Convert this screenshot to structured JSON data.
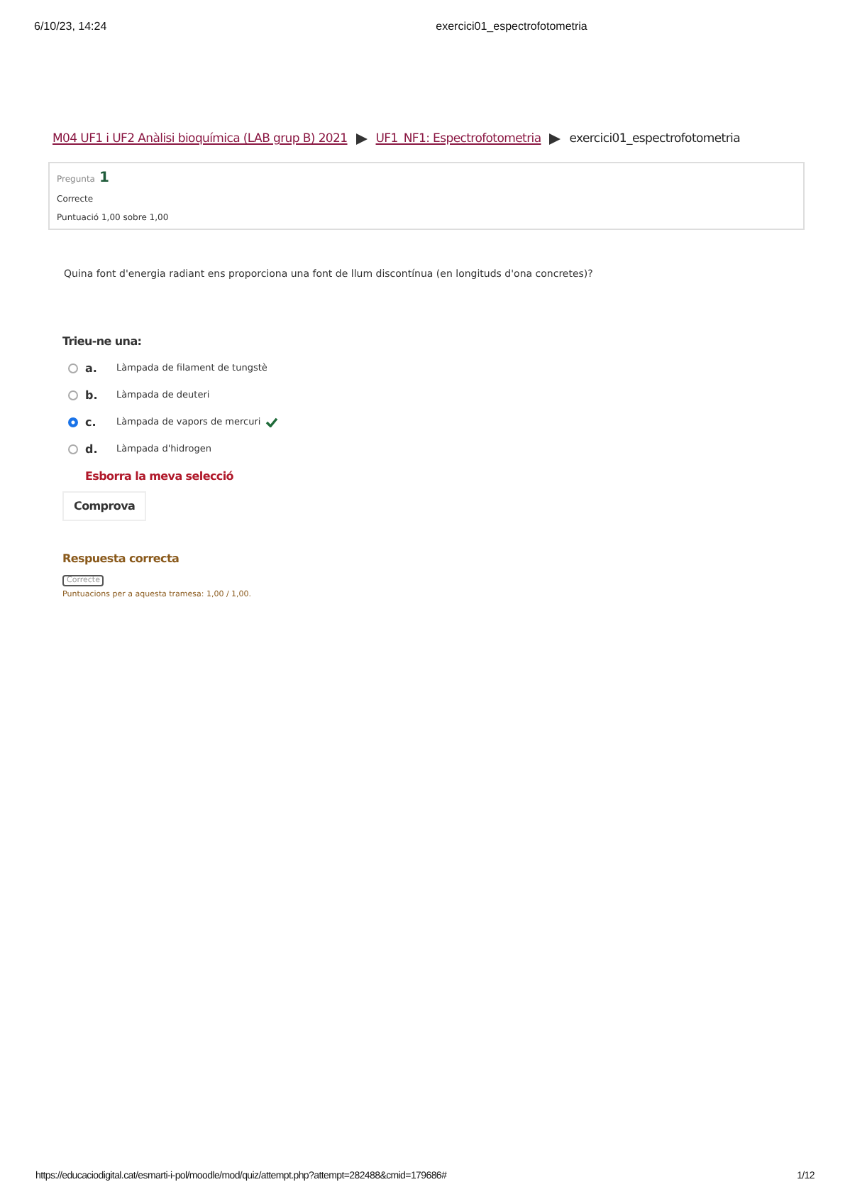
{
  "print_header": {
    "date": "6/10/23, 14:24",
    "title": "exercici01_espectrofotometria"
  },
  "breadcrumb": [
    {
      "label": "M04 UF1 i UF2 Anàlisi bioquímica (LAB grup B) 2021",
      "kind": "link"
    },
    {
      "label": "UF1_NF1: Espectrofotometria",
      "kind": "link"
    },
    {
      "label": "exercici01_espectrofotometria",
      "kind": "current"
    }
  ],
  "question_info": {
    "label": "Pregunta",
    "number": "1",
    "state": "Correcte",
    "grade": "Puntuació 1,00 sobre 1,00"
  },
  "question_text": "Quina font d'energia radiant ens proporciona una font de llum discontínua (en longituds d'ona concretes)?",
  "prompt": "Trieu-ne una:",
  "options": [
    {
      "letter": "a.",
      "label": "Làmpada de filament de tungstè",
      "selected": false,
      "correct": false
    },
    {
      "letter": "b.",
      "label": "Làmpada de deuteri",
      "selected": false,
      "correct": false
    },
    {
      "letter": "c.",
      "label": "Làmpada de vapors de mercuri",
      "selected": true,
      "correct": true
    },
    {
      "letter": "d.",
      "label": "Làmpada d'hidrogen",
      "selected": false,
      "correct": false
    }
  ],
  "clear_link": "Esborra la meva selecció",
  "check_button": "Comprova",
  "feedback": {
    "title": "Respuesta correcta",
    "badge": "Correcte",
    "marks": "Puntuacions per a aquesta tramesa: 1,00 / 1,00."
  },
  "print_footer": {
    "url": "https://educaciodigital.cat/esmarti-i-pol/moodle/mod/quiz/attempt.php?attempt=282488&cmid=179686#",
    "page": "1/12"
  }
}
